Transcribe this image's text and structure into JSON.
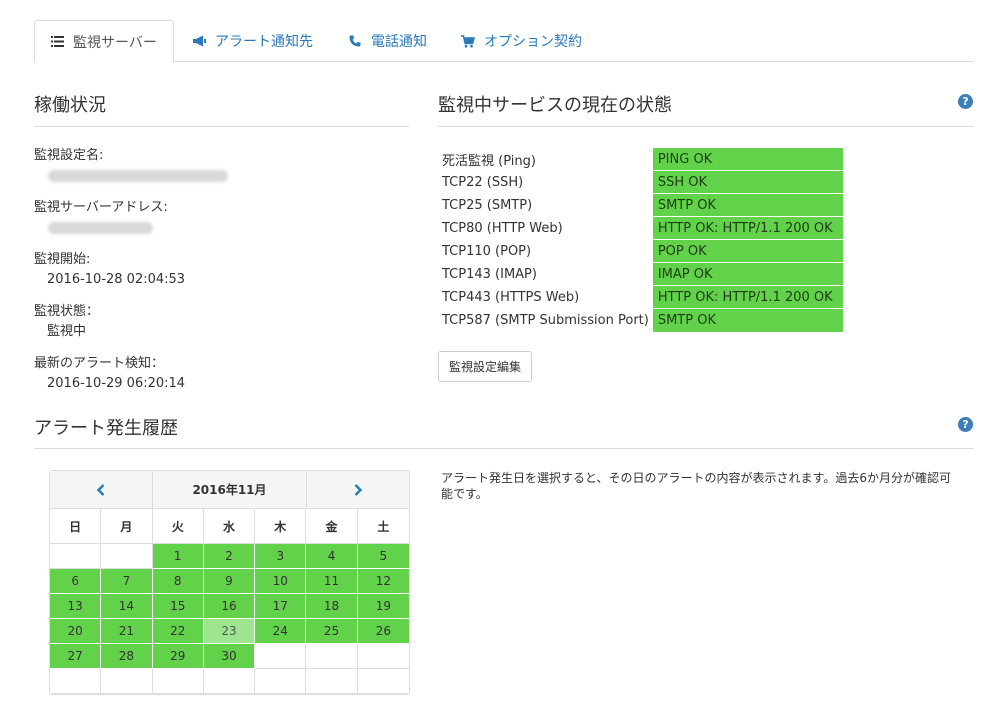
{
  "tabs": [
    {
      "label": "監視サーバー",
      "icon": "list-icon"
    },
    {
      "label": "アラート通知先",
      "icon": "megaphone-icon"
    },
    {
      "label": "電話通知",
      "icon": "phone-icon"
    },
    {
      "label": "オプション契約",
      "icon": "cart-icon"
    }
  ],
  "operation": {
    "title": "稼働状況",
    "fields": [
      {
        "label": "監視設定名:",
        "value": "",
        "masked": true
      },
      {
        "label": "監視サーバーアドレス:",
        "value": "",
        "masked": true
      },
      {
        "label": "監視開始:",
        "value": "2016-10-28 02:04:53"
      },
      {
        "label": "監視状態：",
        "value": "監視中"
      },
      {
        "label": "最新のアラート検知：",
        "value": "2016-10-29 06:20:14"
      }
    ]
  },
  "services": {
    "title": "監視中サービスの現在の状態",
    "help": "?",
    "rows": [
      {
        "service": "死活監視 (Ping)",
        "status": "PING OK"
      },
      {
        "service": "TCP22 (SSH)",
        "status": "SSH OK"
      },
      {
        "service": "TCP25 (SMTP)",
        "status": "SMTP OK"
      },
      {
        "service": "TCP80 (HTTP Web)",
        "status": "HTTP OK: HTTP/1.1 200 OK"
      },
      {
        "service": "TCP110 (POP)",
        "status": "POP OK"
      },
      {
        "service": "TCP143 (IMAP)",
        "status": "IMAP OK"
      },
      {
        "service": "TCP443 (HTTPS Web)",
        "status": "HTTP OK: HTTP/1.1 200 OK"
      },
      {
        "service": "TCP587 (SMTP Submission Port)",
        "status": "SMTP OK"
      }
    ],
    "edit_button": "監視設定編集",
    "ok_color": "#61d24a"
  },
  "history": {
    "title": "アラート発生履歴",
    "help": "?",
    "hint": "アラート発生日を選択すると、その日のアラートの内容が表示されます。過去6か月分が確認可能です。",
    "calendar": {
      "title": "2016年11月",
      "prev": "‹",
      "next": "›",
      "weekdays": [
        "日",
        "月",
        "火",
        "水",
        "木",
        "金",
        "土"
      ],
      "leading_blanks": 2,
      "days_in_month": 30,
      "alert_days": [
        1,
        2,
        3,
        4,
        5,
        6,
        7,
        8,
        9,
        10,
        11,
        12,
        13,
        14,
        15,
        16,
        17,
        18,
        19,
        20,
        21,
        22,
        23,
        24,
        25,
        26,
        27,
        28,
        29,
        30
      ],
      "current_day": 23,
      "total_rows": 6
    }
  }
}
